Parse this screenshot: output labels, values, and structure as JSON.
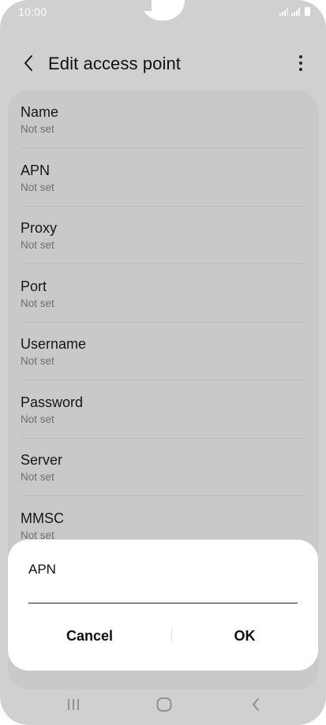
{
  "status_bar": {
    "time": "10:00",
    "icons": [
      "signal-icon",
      "signal-icon",
      "battery-icon"
    ]
  },
  "header": {
    "title": "Edit access point",
    "back_icon": "chevron-left-icon",
    "more_icon": "more-vertical-icon"
  },
  "fields": [
    {
      "label": "Name",
      "value": "Not set"
    },
    {
      "label": "APN",
      "value": "Not set"
    },
    {
      "label": "Proxy",
      "value": "Not set"
    },
    {
      "label": "Port",
      "value": "Not set"
    },
    {
      "label": "Username",
      "value": "Not set"
    },
    {
      "label": "Password",
      "value": "Not set"
    },
    {
      "label": "Server",
      "value": "Not set"
    },
    {
      "label": "MMSC",
      "value": "Not set"
    }
  ],
  "dialog": {
    "title": "APN",
    "input_value": "",
    "cancel_label": "Cancel",
    "ok_label": "OK"
  },
  "nav_bar": {
    "icons": [
      "recent-apps-icon",
      "home-icon",
      "back-icon"
    ]
  },
  "colors": {
    "scrim_background": "#d0d0d0",
    "list_card": "#c9c9c9",
    "dialog_background": "#ffffff"
  }
}
